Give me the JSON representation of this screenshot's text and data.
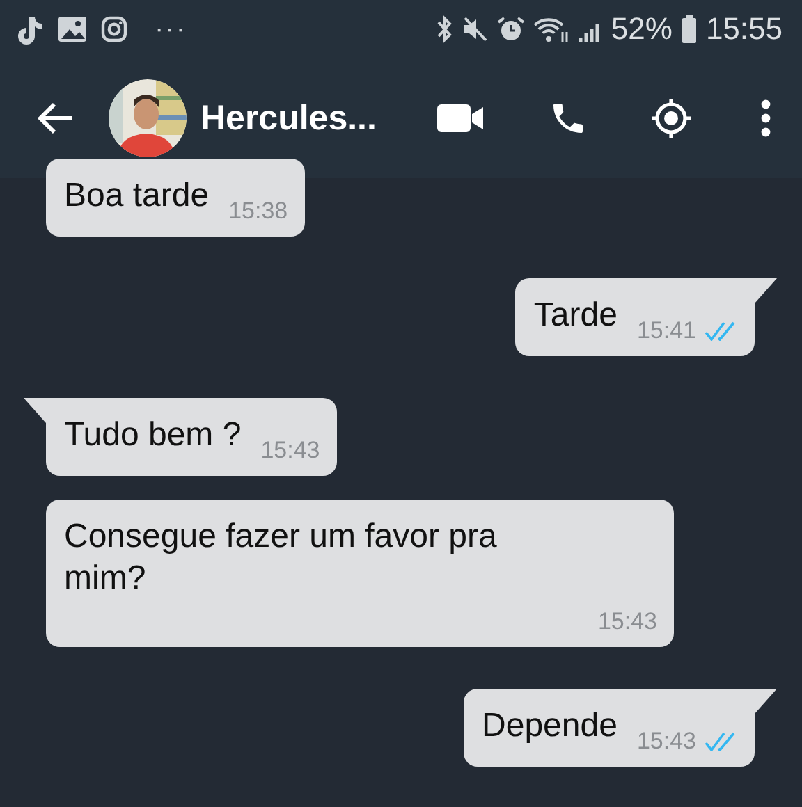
{
  "status_bar": {
    "more": "···",
    "battery": "52%",
    "time": "15:55"
  },
  "header": {
    "contact_name": "Hercules..."
  },
  "messages": [
    {
      "text": "Boa tarde",
      "time": "15:38",
      "kind": "incoming",
      "tail": false,
      "read": false
    },
    {
      "text": "Tarde",
      "time": "15:41",
      "kind": "outgoing",
      "tail": true,
      "read": true
    },
    {
      "text": "Tudo bem ?",
      "time": "15:43",
      "kind": "incoming",
      "tail": true,
      "read": false
    },
    {
      "text": "Consegue fazer um favor pra mim?",
      "time": "15:43",
      "kind": "incoming",
      "tail": false,
      "read": false
    },
    {
      "text": "Depende",
      "time": "15:43",
      "kind": "outgoing",
      "tail": true,
      "read": true
    }
  ]
}
